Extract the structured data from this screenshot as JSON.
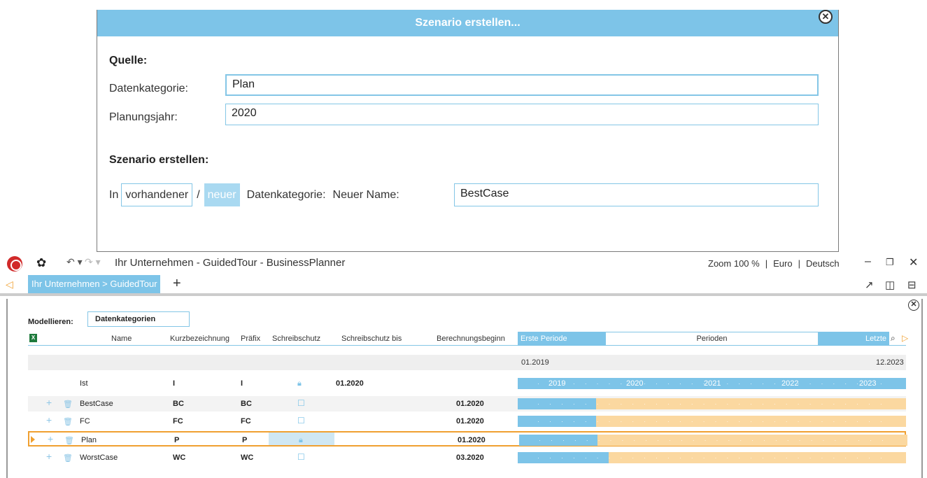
{
  "dialog": {
    "title": "Szenario erstellen...",
    "source_heading": "Quelle:",
    "datenkategorie_label": "Datenkategorie:",
    "datenkategorie_value": "Plan",
    "planungsjahr_label": "Planungsjahr:",
    "planungsjahr_value": "2020",
    "create_heading": "Szenario erstellen:",
    "in_label": "In",
    "option_existing": "vorhandener",
    "slash": "/",
    "option_new": "neuer",
    "datenkategorie_suffix": "Datenkategorie:",
    "new_name_label": "Neuer Name:",
    "new_name_value": "BestCase"
  },
  "titlebar": {
    "title": "Ihr Unternehmen - GuidedTour - BusinessPlanner",
    "zoom": "Zoom  100 %",
    "currency": "Euro",
    "language": "Deutsch",
    "separator": "|"
  },
  "tabbar": {
    "active_tab": "Ihr Unternehmen > GuidedTour",
    "add_tab": "+"
  },
  "toolbar": {
    "modellieren_label": "Modellieren:",
    "modellieren_value": "Datenkategorien"
  },
  "grid": {
    "columns": {
      "name": "Name",
      "kurz": "Kurzbezeichnung",
      "praefix": "Präfix",
      "schreibschutz": "Schreibschutz",
      "schreibschutz_bis": "Schreibschutz bis",
      "berechnungsbeginn": "Berechnungsbeginn",
      "erste_periode": "Erste Periode",
      "perioden": "Perioden",
      "letzte": "Letzte"
    },
    "range_start": "01.2019",
    "range_end": "12.2023",
    "years": [
      "2019",
      "2020",
      "2021",
      "2022",
      "2023"
    ],
    "rows": [
      {
        "name": "Ist",
        "kurz": "I",
        "praefix": "I",
        "locked": true,
        "schreibschutz_bis": "01.2020",
        "berechnungsbeginn": "",
        "selected": false,
        "editable": false
      },
      {
        "name": "BestCase",
        "kurz": "BC",
        "praefix": "BC",
        "locked": false,
        "schreibschutz_bis": "",
        "berechnungsbeginn": "01.2020",
        "selected": false,
        "editable": true
      },
      {
        "name": "FC",
        "kurz": "FC",
        "praefix": "FC",
        "locked": false,
        "schreibschutz_bis": "",
        "berechnungsbeginn": "01.2020",
        "selected": false,
        "editable": true
      },
      {
        "name": "Plan",
        "kurz": "P",
        "praefix": "P",
        "locked": true,
        "schreibschutz_bis": "",
        "berechnungsbeginn": "01.2020",
        "selected": true,
        "editable": true
      },
      {
        "name": "WorstCase",
        "kurz": "WC",
        "praefix": "WC",
        "locked": false,
        "schreibschutz_bis": "",
        "berechnungsbeginn": "03.2020",
        "selected": false,
        "editable": true
      }
    ]
  }
}
